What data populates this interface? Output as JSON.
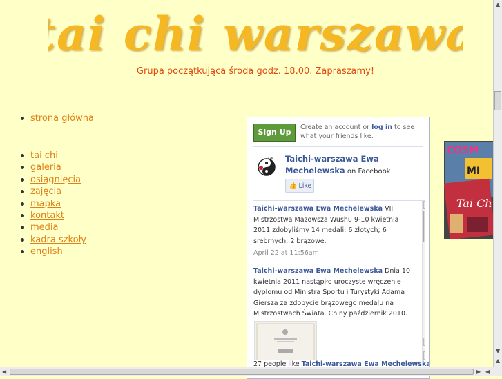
{
  "logo": {
    "text": "tai chi warszawa"
  },
  "tagline": "Grupa początkująca środa godz. 18.00. Zapraszamy!",
  "nav_top": [
    {
      "label": "strona główna"
    }
  ],
  "nav_main": [
    {
      "label": "tai chi"
    },
    {
      "label": "galeria"
    },
    {
      "label": "osiągnięcia"
    },
    {
      "label": "zajęcia"
    },
    {
      "label": "mapka"
    },
    {
      "label": "kontakt"
    },
    {
      "label": "media"
    },
    {
      "label": "kadra szkoły"
    },
    {
      "label": "english"
    }
  ],
  "facebook": {
    "signup_label": "Sign Up",
    "create_text_before": "Create an account or ",
    "login_label": "log in",
    "create_text_after": " to see what your friends like.",
    "page_name": "Taichi-warszawa Ewa Mechelewska",
    "on_facebook": " on Facebook",
    "like_label": "Like",
    "posts": [
      {
        "author": "Taichi-warszawa Ewa Mechelewska",
        "text": " VII Mistrzostwa Mazowsza Wushu 9-10 kwietnia 2011 zdobyliśmy 14 medali: 6 złotych; 6 srebrnych; 2 brązowe.",
        "date": "April 22 at 11:56am"
      },
      {
        "author": "Taichi-warszawa Ewa Mechelewska",
        "text": " Dnia 10 kwietnia 2011 nastąpiło uroczyste wręczenie dyplomu od Ministra Sportu i Turystyki Adama Giersza za zdobycie brązowego medalu na Mistrzostwach Świata. Chiny październik 2010.",
        "date": ""
      }
    ],
    "people_like_count": "27 people like ",
    "people_like_name": "Taichi-warszawa Ewa Mechelewska"
  },
  "colors": {
    "background": "#ffffc8",
    "logo": "#f5b821",
    "tagline": "#e04a10",
    "nav_link": "#e08018",
    "facebook_blue": "#3b5998",
    "signup_green": "#5f9a3c"
  }
}
